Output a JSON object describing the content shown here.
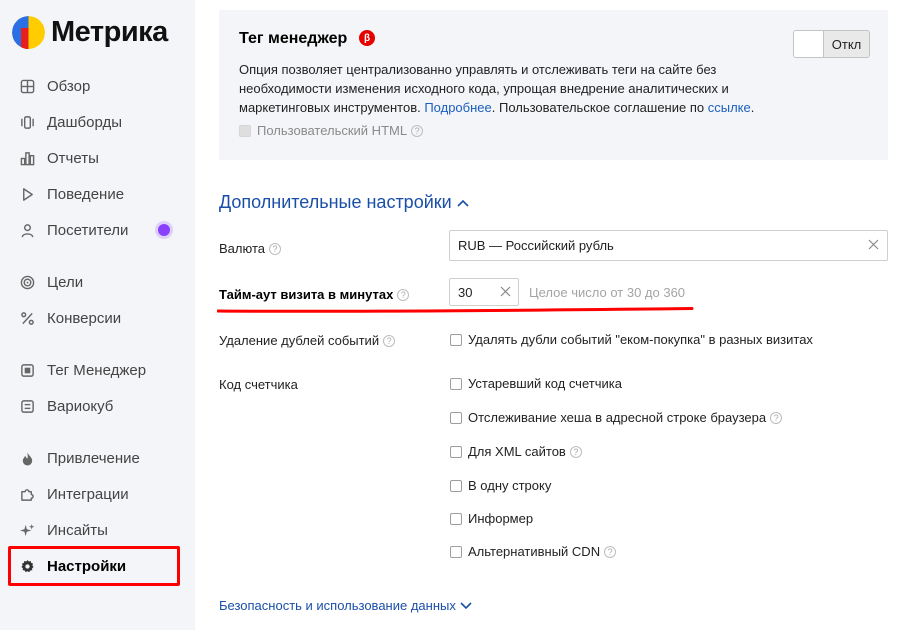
{
  "app": {
    "name": "Метрика",
    "accent": "#1a4fa8",
    "link_color": "#1a5fbf",
    "highlight_color": "#ff0000"
  },
  "sidebar": {
    "items": [
      {
        "label": "Обзор",
        "icon": "grid-icon"
      },
      {
        "label": "Дашборды",
        "icon": "dashboard-icon"
      },
      {
        "label": "Отчеты",
        "icon": "bar-chart-icon"
      },
      {
        "label": "Поведение",
        "icon": "play-icon"
      },
      {
        "label": "Посетители",
        "icon": "person-icon",
        "badge": "new-dot"
      },
      {
        "label": "Цели",
        "icon": "target-icon"
      },
      {
        "label": "Конверсии",
        "icon": "percent-icon"
      },
      {
        "label": "Тег Менеджер",
        "icon": "tag-manager-icon"
      },
      {
        "label": "Вариокуб",
        "icon": "variocube-icon"
      },
      {
        "label": "Привлечение",
        "icon": "flame-icon"
      },
      {
        "label": "Интеграции",
        "icon": "puzzle-icon"
      },
      {
        "label": "Инсайты",
        "icon": "sparkle-icon"
      },
      {
        "label": "Настройки",
        "icon": "gear-icon",
        "active": true
      }
    ]
  },
  "tag_manager": {
    "title": "Тег менеджер",
    "badge": "β",
    "desc_before": "Опция позволяет централизованно управлять и отслеживать теги на сайте без необходимости изменения исходного кода, упрощая внедрение аналитических и маркетинговых инструментов. ",
    "link_more": "Подробнее",
    "desc_middle": ". Пользовательское соглашение по ",
    "link_agreement": "ссылке",
    "desc_after": ".",
    "custom_html_label": "Пользовательский HTML",
    "toggle_label": "Откл"
  },
  "advanced": {
    "title": "Дополнительные настройки",
    "currency_label": "Валюта",
    "currency_value": "RUB — Российский рубль",
    "timeout_label": "Тайм-аут визита в минутах",
    "timeout_value": "30",
    "timeout_hint": "Целое число от 30 до 360",
    "dedupe_label": "Удаление дублей событий",
    "dedupe_option": "Удалять дубли событий \"еком-покупка\" в разных визитах",
    "code_label": "Код счетчика",
    "code_options": [
      "Устаревший код счетчика",
      "Отслеживание хеша в адресной строке браузера",
      "Для XML сайтов",
      "В одну строку",
      "Информер",
      "Альтернативный CDN"
    ]
  },
  "footer": {
    "security_link": "Безопасность и использование данных"
  }
}
